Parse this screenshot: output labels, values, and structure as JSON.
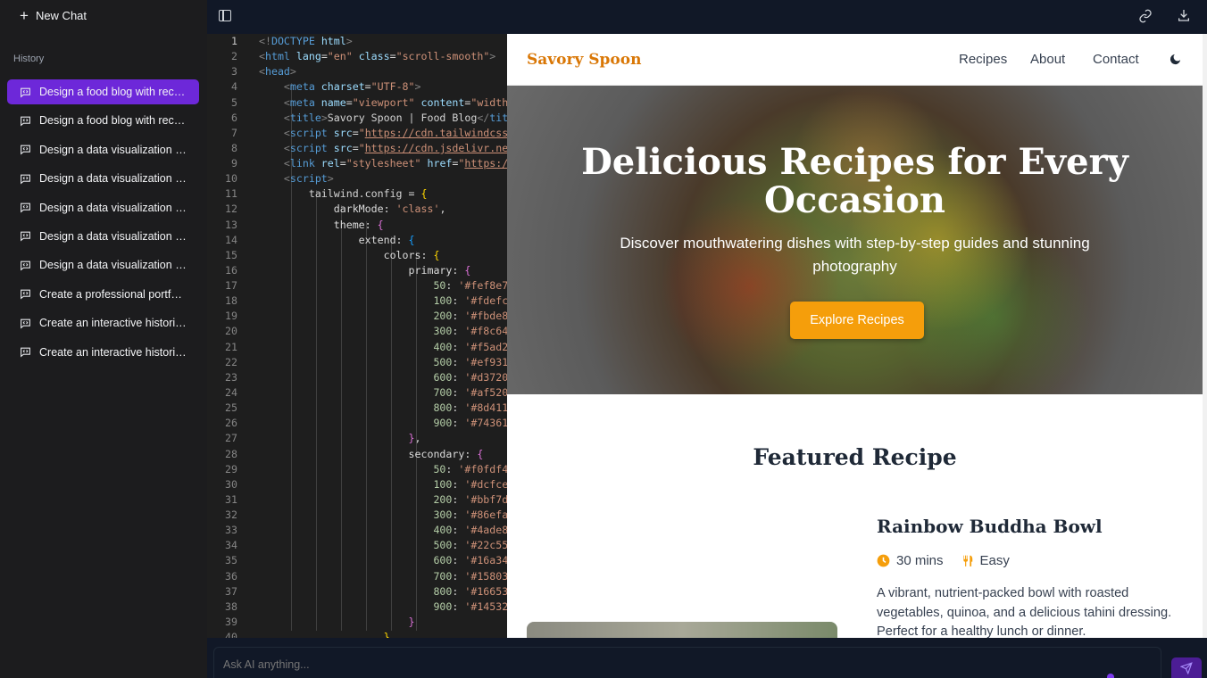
{
  "sidebar": {
    "new_chat": "New Chat",
    "history_label": "History",
    "items": [
      "Design a food blog with recip…",
      "Design a food blog with recip…",
      "Design a data visualization p…",
      "Design a data visualization p…",
      "Design a data visualization p…",
      "Design a data visualization p…",
      "Design a data visualization p…",
      "Create a professional portfoli…",
      "Create an interactive historic…",
      "Create an interactive historic…"
    ]
  },
  "editor": {
    "lines": [
      [
        [
          "tg",
          "<!"
        ],
        [
          "tn",
          "DOCTYPE"
        ],
        [
          "at",
          " html"
        ],
        [
          "tg",
          ">"
        ]
      ],
      [
        [
          "tg",
          "<"
        ],
        [
          "tn",
          "html"
        ],
        [
          "at",
          " lang"
        ],
        [
          "pl",
          "="
        ],
        [
          "st",
          "\"en\""
        ],
        [
          "at",
          " class"
        ],
        [
          "pl",
          "="
        ],
        [
          "st",
          "\"scroll-smooth\""
        ],
        [
          "tg",
          ">"
        ]
      ],
      [
        [
          "tg",
          "<"
        ],
        [
          "tn",
          "head"
        ],
        [
          "tg",
          ">"
        ]
      ],
      [
        [
          "pl",
          "    "
        ],
        [
          "tg",
          "<"
        ],
        [
          "tn",
          "meta"
        ],
        [
          "at",
          " charset"
        ],
        [
          "pl",
          "="
        ],
        [
          "st",
          "\"UTF-8\""
        ],
        [
          "tg",
          ">"
        ]
      ],
      [
        [
          "pl",
          "    "
        ],
        [
          "tg",
          "<"
        ],
        [
          "tn",
          "meta"
        ],
        [
          "at",
          " name"
        ],
        [
          "pl",
          "="
        ],
        [
          "st",
          "\"viewport\""
        ],
        [
          "at",
          " content"
        ],
        [
          "pl",
          "="
        ],
        [
          "st",
          "\"width"
        ]
      ],
      [
        [
          "pl",
          "    "
        ],
        [
          "tg",
          "<"
        ],
        [
          "tn",
          "title"
        ],
        [
          "tg",
          ">"
        ],
        [
          "pl",
          "Savory Spoon | Food Blog"
        ],
        [
          "tg",
          "</"
        ],
        [
          "tn",
          "tit"
        ]
      ],
      [
        [
          "pl",
          "    "
        ],
        [
          "tg",
          "<"
        ],
        [
          "tn",
          "script"
        ],
        [
          "at",
          " src"
        ],
        [
          "pl",
          "="
        ],
        [
          "st",
          "\""
        ],
        [
          "sl",
          "https://cdn.tailwindcss"
        ]
      ],
      [
        [
          "pl",
          "    "
        ],
        [
          "tg",
          "<"
        ],
        [
          "tn",
          "script"
        ],
        [
          "at",
          " src"
        ],
        [
          "pl",
          "="
        ],
        [
          "st",
          "\""
        ],
        [
          "sl",
          "https://cdn.jsdelivr.ne"
        ]
      ],
      [
        [
          "pl",
          "    "
        ],
        [
          "tg",
          "<"
        ],
        [
          "tn",
          "link"
        ],
        [
          "at",
          " rel"
        ],
        [
          "pl",
          "="
        ],
        [
          "st",
          "\"stylesheet\""
        ],
        [
          "at",
          " href"
        ],
        [
          "pl",
          "="
        ],
        [
          "st",
          "\""
        ],
        [
          "sl",
          "https:/"
        ]
      ],
      [
        [
          "pl",
          "    "
        ],
        [
          "tg",
          "<"
        ],
        [
          "tn",
          "script"
        ],
        [
          "tg",
          ">"
        ]
      ],
      [
        [
          "pl",
          "        tailwind.config = "
        ],
        [
          "b1",
          "{"
        ]
      ],
      [
        [
          "ky",
          "            darkMode: "
        ],
        [
          "st",
          "'class'"
        ],
        [
          "pl",
          ","
        ]
      ],
      [
        [
          "ky",
          "            theme: "
        ],
        [
          "b2",
          "{"
        ]
      ],
      [
        [
          "ky",
          "                extend: "
        ],
        [
          "b3",
          "{"
        ]
      ],
      [
        [
          "ky",
          "                    colors: "
        ],
        [
          "b1",
          "{"
        ]
      ],
      [
        [
          "ky",
          "                        primary: "
        ],
        [
          "b2",
          "{"
        ]
      ],
      [
        [
          "nu",
          "                            50"
        ],
        [
          "pl",
          ": "
        ],
        [
          "st",
          "'#fef8e7"
        ]
      ],
      [
        [
          "nu",
          "                            100"
        ],
        [
          "pl",
          ": "
        ],
        [
          "st",
          "'#fdefc"
        ]
      ],
      [
        [
          "nu",
          "                            200"
        ],
        [
          "pl",
          ": "
        ],
        [
          "st",
          "'#fbde8"
        ]
      ],
      [
        [
          "nu",
          "                            300"
        ],
        [
          "pl",
          ": "
        ],
        [
          "st",
          "'#f8c64"
        ]
      ],
      [
        [
          "nu",
          "                            400"
        ],
        [
          "pl",
          ": "
        ],
        [
          "st",
          "'#f5ad2"
        ]
      ],
      [
        [
          "nu",
          "                            500"
        ],
        [
          "pl",
          ": "
        ],
        [
          "st",
          "'#ef931"
        ]
      ],
      [
        [
          "nu",
          "                            600"
        ],
        [
          "pl",
          ": "
        ],
        [
          "st",
          "'#d3720"
        ]
      ],
      [
        [
          "nu",
          "                            700"
        ],
        [
          "pl",
          ": "
        ],
        [
          "st",
          "'#af520"
        ]
      ],
      [
        [
          "nu",
          "                            800"
        ],
        [
          "pl",
          ": "
        ],
        [
          "st",
          "'#8d411"
        ]
      ],
      [
        [
          "nu",
          "                            900"
        ],
        [
          "pl",
          ": "
        ],
        [
          "st",
          "'#74361"
        ]
      ],
      [
        [
          "pl",
          "                        "
        ],
        [
          "b2",
          "}"
        ],
        [
          "pl",
          ","
        ]
      ],
      [
        [
          "ky",
          "                        secondary: "
        ],
        [
          "b2",
          "{"
        ]
      ],
      [
        [
          "nu",
          "                            50"
        ],
        [
          "pl",
          ": "
        ],
        [
          "st",
          "'#f0fdf4"
        ]
      ],
      [
        [
          "nu",
          "                            100"
        ],
        [
          "pl",
          ": "
        ],
        [
          "st",
          "'#dcfce"
        ]
      ],
      [
        [
          "nu",
          "                            200"
        ],
        [
          "pl",
          ": "
        ],
        [
          "st",
          "'#bbf7d"
        ]
      ],
      [
        [
          "nu",
          "                            300"
        ],
        [
          "pl",
          ": "
        ],
        [
          "st",
          "'#86efa"
        ]
      ],
      [
        [
          "nu",
          "                            400"
        ],
        [
          "pl",
          ": "
        ],
        [
          "st",
          "'#4ade8"
        ]
      ],
      [
        [
          "nu",
          "                            500"
        ],
        [
          "pl",
          ": "
        ],
        [
          "st",
          "'#22c55"
        ]
      ],
      [
        [
          "nu",
          "                            600"
        ],
        [
          "pl",
          ": "
        ],
        [
          "st",
          "'#16a34"
        ]
      ],
      [
        [
          "nu",
          "                            700"
        ],
        [
          "pl",
          ": "
        ],
        [
          "st",
          "'#15803"
        ]
      ],
      [
        [
          "nu",
          "                            800"
        ],
        [
          "pl",
          ": "
        ],
        [
          "st",
          "'#16653"
        ]
      ],
      [
        [
          "nu",
          "                            900"
        ],
        [
          "pl",
          ": "
        ],
        [
          "st",
          "'#14532"
        ]
      ],
      [
        [
          "pl",
          "                        "
        ],
        [
          "b2",
          "}"
        ]
      ],
      [
        [
          "pl",
          "                    "
        ],
        [
          "b1",
          "}"
        ]
      ]
    ]
  },
  "preview": {
    "logo": "Savory Spoon",
    "nav": [
      "Recipes",
      "About",
      "Contact"
    ],
    "hero_title": "Delicious Recipes for Every Occasion",
    "hero_subtitle": "Discover mouthwatering dishes with step-by-step guides and stunning photography",
    "hero_button": "Explore Recipes",
    "featured_heading": "Featured Recipe",
    "recipe": {
      "title": "Rainbow Buddha Bowl",
      "time": "30 mins",
      "difficulty": "Easy",
      "description": "A vibrant, nutrient-packed bowl with roasted vegetables, quinoa, and a delicious tahini dressing. Perfect for a healthy lunch or dinner."
    },
    "accent": "#f59e0b"
  },
  "input": {
    "placeholder": "Ask AI anything..."
  }
}
